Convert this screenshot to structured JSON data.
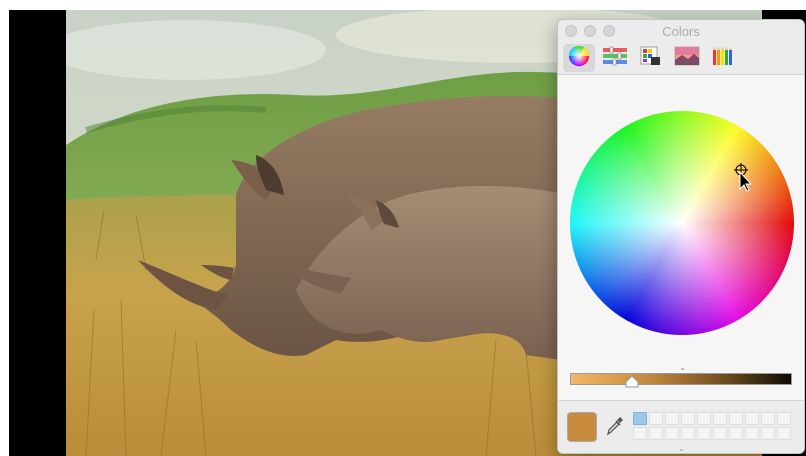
{
  "panel": {
    "title": "Colors",
    "toolbar": [
      {
        "name": "color-wheel-tab-icon",
        "selected": true
      },
      {
        "name": "color-sliders-tab-icon",
        "selected": false
      },
      {
        "name": "color-palettes-tab-icon",
        "selected": false
      },
      {
        "name": "image-palettes-tab-icon",
        "selected": false
      },
      {
        "name": "pencils-tab-icon",
        "selected": false
      }
    ],
    "brightness": 0.28,
    "current_color": "#c98c3f",
    "swatches": {
      "rows": 2,
      "columns": 10,
      "filled": [
        "#9bc8e6"
      ]
    }
  },
  "background": {
    "image": "rhinoceros-photo",
    "colors": {
      "sky": "#c9d6c6",
      "hill": "#77a84a",
      "grass": "#c9a54f",
      "rhino": "#8a6e55"
    }
  }
}
